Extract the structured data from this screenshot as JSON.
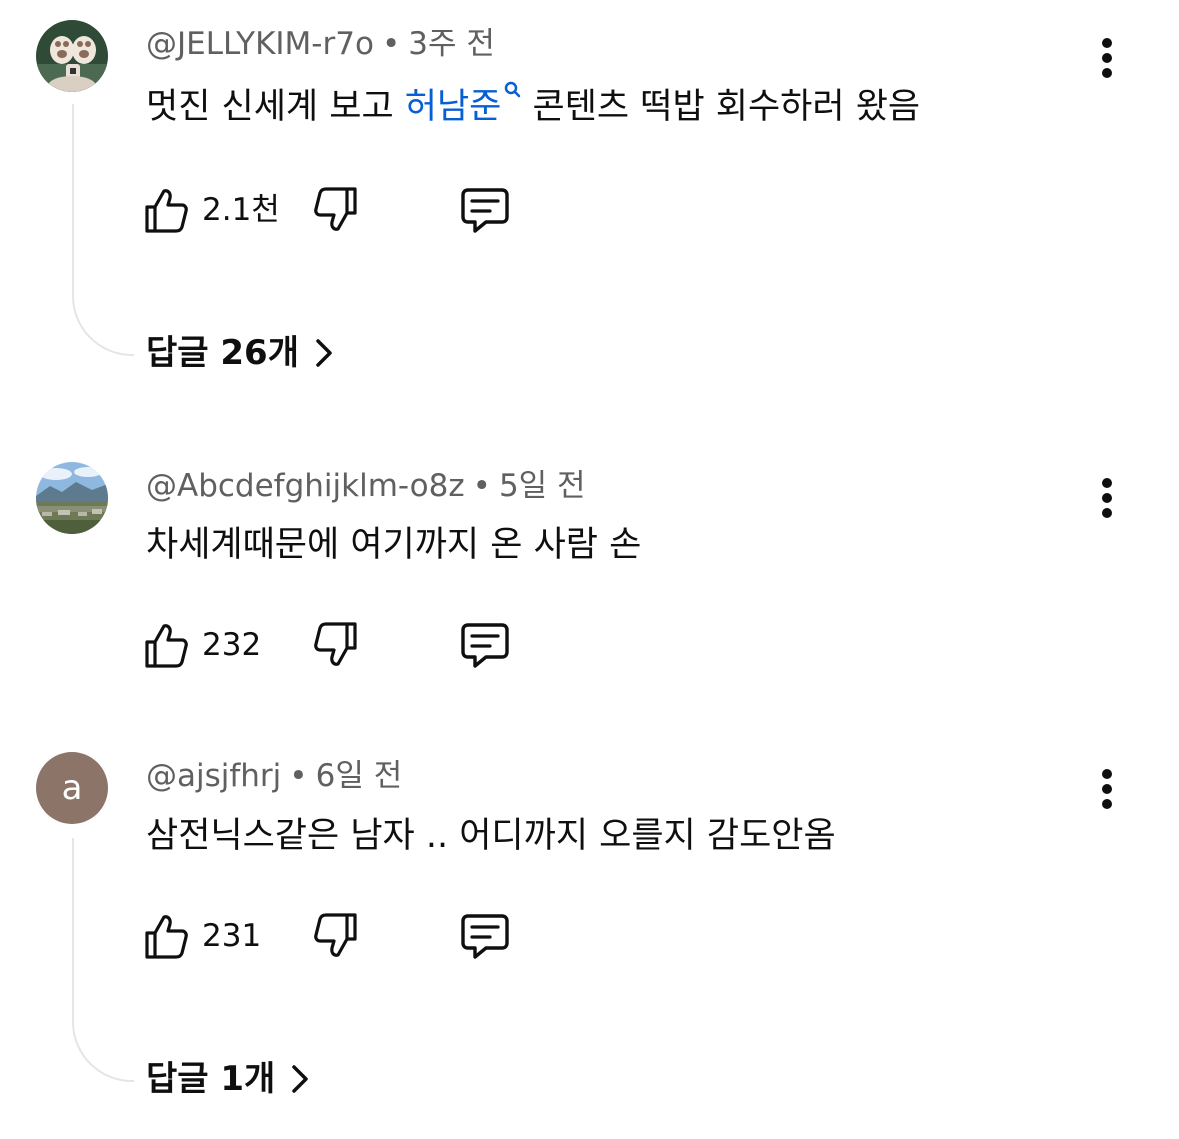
{
  "comments": [
    {
      "avatar_icon": "cat-paws-photo-avatar",
      "author": "@JELLYKIM-r7o",
      "separator": "•",
      "time": "3주 전",
      "text_before": "멋진 신세계 보고 ",
      "link_text": "허남준",
      "link_icon": "search-icon",
      "text_after": " 콘텐츠 떡밥 회수하러 왔음",
      "likes": "2.1천",
      "replies_label": "답글 26개"
    },
    {
      "avatar_icon": "landscape-photo-avatar",
      "author": "@Abcdefghijklm-o8z",
      "separator": "•",
      "time": "5일 전",
      "text": "차세계때문에 여기까지 온 사람 손",
      "likes": "232"
    },
    {
      "avatar_letter": "a",
      "author": "@ajsjfhrj",
      "separator": "•",
      "time": "6일 전",
      "text": "삼전닉스같은 남자 .. 어디까지 오를지 감도안옴",
      "likes": "231",
      "replies_label": "답글 1개"
    }
  ],
  "icons": {
    "like": "thumbs-up-icon",
    "dislike": "thumbs-down-icon",
    "reply": "reply-icon",
    "more": "more-vertical-icon",
    "expand": "chevron-right-icon"
  },
  "colors": {
    "link": "#065fd4",
    "meta_text": "#606060",
    "body_text": "#0f0f0f",
    "thread_line": "#e5e5e5",
    "letter_avatar": "#8d7468"
  }
}
